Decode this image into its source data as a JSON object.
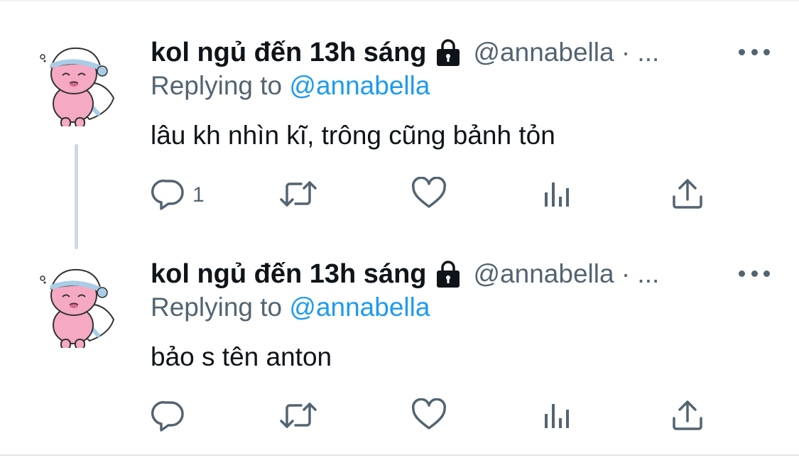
{
  "tweets": [
    {
      "display_name": "kol ngủ đến 13h sáng",
      "handle": "@annabella · ...",
      "replying_prefix": "Replying to",
      "replying_handle": "@annabella",
      "text": "lâu kh nhìn kĩ, trông cũng bảnh tỏn",
      "reply_count": "1"
    },
    {
      "display_name": "kol ngủ đến 13h sáng",
      "handle": "@annabella · ...",
      "replying_prefix": "Replying to",
      "replying_handle": "@annabella",
      "text": "bảo s tên anton",
      "reply_count": ""
    }
  ],
  "icons": [
    "lock-icon",
    "more-icon",
    "reply-icon",
    "retweet-icon",
    "like-icon",
    "views-icon",
    "share-icon"
  ],
  "colors": {
    "text": "#0f1419",
    "secondary": "#536471",
    "link": "#1d9bf0",
    "thread_line": "#cfd9de",
    "avatar_pink": "#f5a9c3",
    "avatar_blue": "#a9cde6"
  }
}
